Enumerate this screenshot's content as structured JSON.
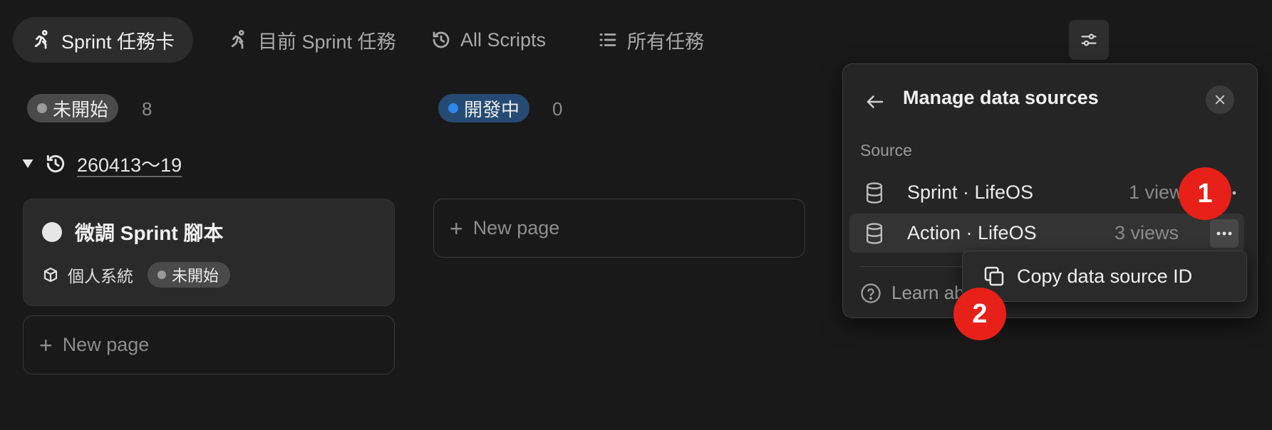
{
  "tabs": [
    {
      "label": "Sprint 任務卡",
      "icon": "running-icon",
      "active": true
    },
    {
      "label": "目前 Sprint 任務",
      "icon": "running-icon",
      "active": false
    },
    {
      "label": "All Scripts",
      "icon": "history-icon",
      "active": false
    },
    {
      "label": "所有任務",
      "icon": "list-icon",
      "active": false
    }
  ],
  "columns": [
    {
      "status": "未開始",
      "count": "8",
      "color": "#9a9a9a"
    },
    {
      "status": "開發中",
      "count": "0",
      "color": "#2f86eb"
    }
  ],
  "group": {
    "title": "260413～19"
  },
  "card": {
    "title": "微調 Sprint 腳本",
    "project": "個人系統",
    "status": "未開始"
  },
  "new_page_label": "New page",
  "panel": {
    "title": "Manage data sources",
    "section_label": "Source",
    "sources": [
      {
        "name": "Sprint · LifeOS",
        "views": "1 views"
      },
      {
        "name": "Action · LifeOS",
        "views": "3 views"
      }
    ],
    "learn_label": "Learn about data sources"
  },
  "dropdown": {
    "copy_label": "Copy data source ID"
  },
  "annotations": [
    "1",
    "2"
  ],
  "colors": {
    "background": "#191919",
    "badge": "#e8201a",
    "blue_status": "#2f86eb"
  }
}
